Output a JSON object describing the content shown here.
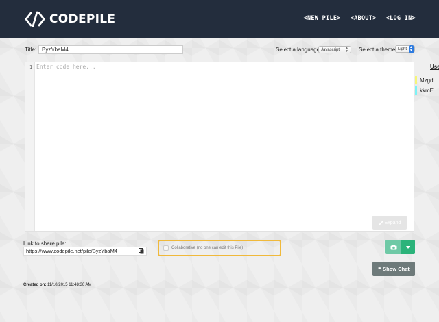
{
  "header": {
    "brand": "CODEPILE",
    "nav": [
      "<NEW PILE>",
      "<ABOUT>",
      "<LOG IN>"
    ]
  },
  "form": {
    "title_label": "Title:",
    "title_value": "ByzYbaM4",
    "language_label": "Select a language:",
    "language_value": "Javascript",
    "theme_label": "Select a theme:",
    "theme_value": "Light"
  },
  "editor": {
    "line_number": "1",
    "placeholder": "Enter code here...",
    "expand_label": "Expand"
  },
  "users": {
    "title": "Use",
    "items": [
      {
        "name": "Mzgd",
        "color": "#f5f57a"
      },
      {
        "name": "kkmE",
        "color": "#7ef2f5"
      }
    ]
  },
  "share": {
    "label": "Link to share pile:",
    "url": "https://www.codepile.net/pile/ByzYbaM4"
  },
  "collab": {
    "label": "Collaborative (no one can edit this Pile)"
  },
  "chat": {
    "label": "Show Chat"
  },
  "meta": {
    "created_label": "Created on:",
    "created_value": "11/10/2015 11:48:36 AM"
  },
  "colors": {
    "header_bg": "#232d3d",
    "accent_green": "#2bb37a",
    "collab_border": "#f0b93b"
  }
}
